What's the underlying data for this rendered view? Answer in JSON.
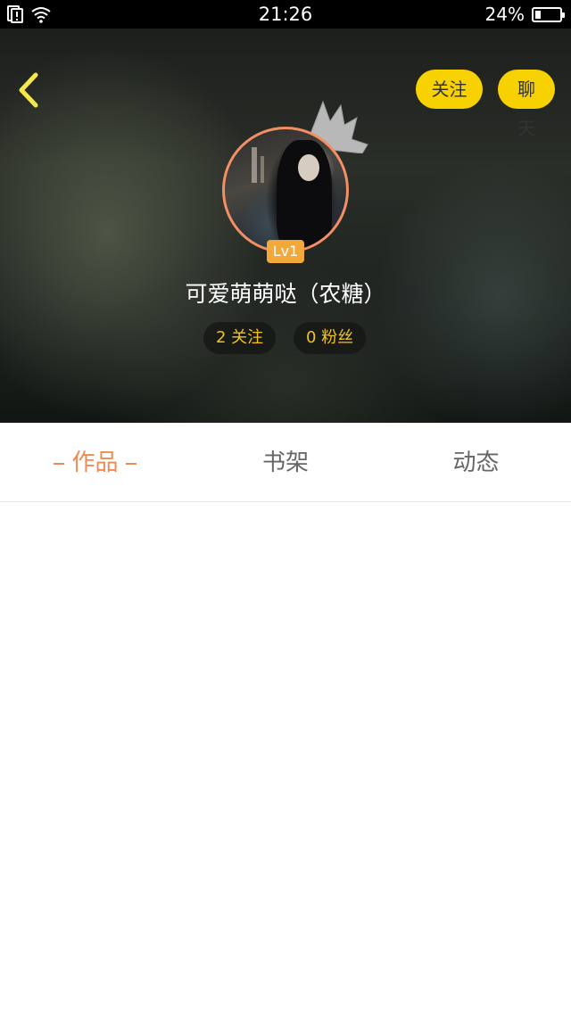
{
  "status_bar": {
    "time": "21:26",
    "battery_percent": "24%",
    "battery_level": 0.24,
    "icons": [
      "sim-alert-icon",
      "wifi-icon",
      "battery-icon"
    ]
  },
  "header": {
    "back_icon": "chevron-left-icon",
    "follow_label": "关注",
    "chat_label": "聊天",
    "level": "Lv1",
    "username": "可爱萌萌哒（农糖）",
    "following_count_label": "2 关注",
    "fans_count_label": "0 粉丝"
  },
  "tabs": {
    "works_label": "作品",
    "shelf_label": "书架",
    "activity_label": "动态",
    "active": "作品"
  },
  "colors": {
    "accent_yellow": "#f7d100",
    "active_tab": "#f08a55",
    "avatar_border": "#f38f64",
    "level_badge": "#f3a93a",
    "stat_text": "#f3c21c"
  }
}
